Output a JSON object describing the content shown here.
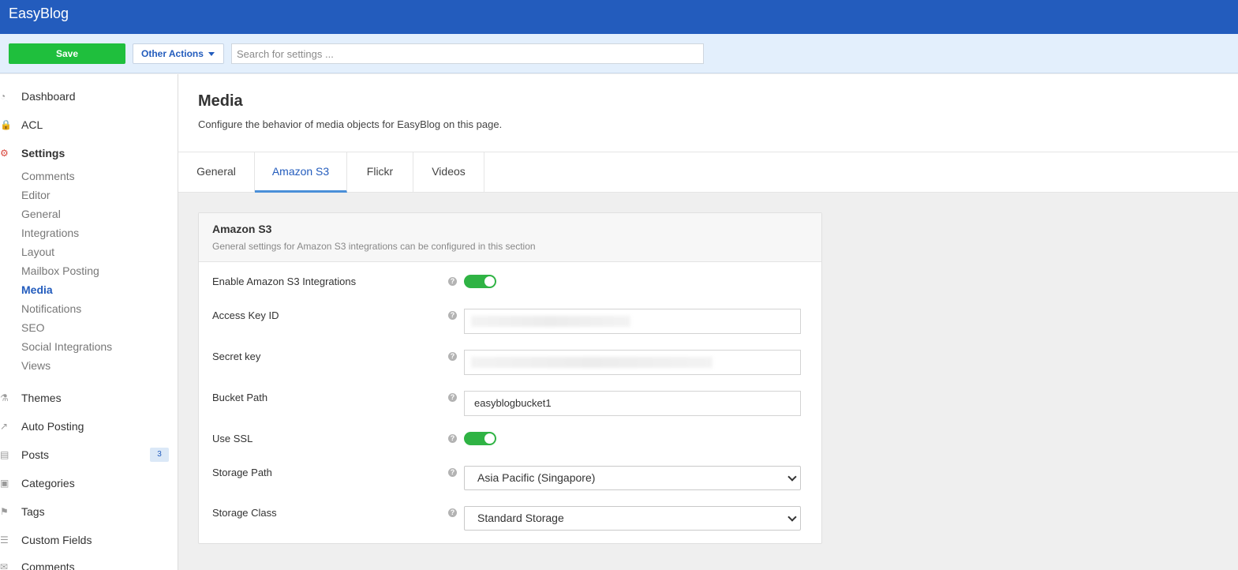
{
  "app": {
    "brand": "EasyBlog"
  },
  "toolbar": {
    "save_label": "Save",
    "other_actions_label": "Other Actions",
    "search_placeholder": "Search for settings ..."
  },
  "sidebar": {
    "main": [
      {
        "label": "Dashboard",
        "icon": "dashboard-icon"
      },
      {
        "label": "ACL",
        "icon": "lock-icon"
      },
      {
        "label": "Settings",
        "icon": "gear-icon"
      },
      {
        "label": "Themes",
        "icon": "flask-icon"
      },
      {
        "label": "Auto Posting",
        "icon": "share-icon"
      },
      {
        "label": "Posts",
        "icon": "document-icon",
        "badge": "3"
      },
      {
        "label": "Categories",
        "icon": "folder-icon"
      },
      {
        "label": "Tags",
        "icon": "tags-icon"
      },
      {
        "label": "Custom Fields",
        "icon": "list-icon"
      },
      {
        "label": "Comments",
        "icon": "comments-icon"
      }
    ],
    "settings_sub": [
      "Comments",
      "Editor",
      "General",
      "Integrations",
      "Layout",
      "Mailbox Posting",
      "Media",
      "Notifications",
      "SEO",
      "Social Integrations",
      "Views"
    ],
    "active_sub": "Media"
  },
  "page": {
    "title": "Media",
    "description": "Configure the behavior of media objects for EasyBlog on this page."
  },
  "tabs": [
    "General",
    "Amazon S3",
    "Flickr",
    "Videos"
  ],
  "active_tab": "Amazon S3",
  "card": {
    "title": "Amazon S3",
    "subtitle": "General settings for Amazon S3 integrations can be configured in this section",
    "rows": {
      "enable": {
        "label": "Enable Amazon S3 Integrations",
        "value": true
      },
      "access_key": {
        "label": "Access Key ID"
      },
      "secret_key": {
        "label": "Secret key"
      },
      "bucket": {
        "label": "Bucket Path",
        "value": "easyblogbucket1"
      },
      "ssl": {
        "label": "Use SSL",
        "value": true
      },
      "storage_path": {
        "label": "Storage Path",
        "value": "Asia Pacific (Singapore)"
      },
      "storage_class": {
        "label": "Storage Class",
        "value": "Standard Storage"
      }
    },
    "help_glyph": "?"
  },
  "colors": {
    "topbar": "#235cbd",
    "save": "#1fbf3d",
    "toggle_on": "#2fb344",
    "accent": "#235cbd"
  }
}
